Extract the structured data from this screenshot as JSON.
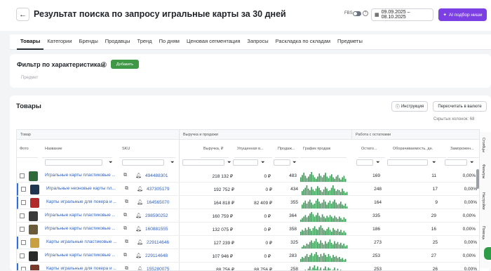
{
  "header": {
    "back_icon": "arrow-left-icon",
    "title": "Результат поиска по запросу игральные карты за 30 дней",
    "fbs_label": "FBS",
    "date_range": "09.09.2025 – 08.10.2025",
    "ai_button": "AI подбор ниши"
  },
  "tabs": [
    "Товары",
    "Категории",
    "Бренды",
    "Продавцы",
    "Тренд",
    "По дням",
    "Ценовая сегментация",
    "Запросы",
    "Раскладка по складам",
    "Предметы"
  ],
  "filter": {
    "title": "Фильтр по характеристикам",
    "add_button": "Добавить",
    "subject_placeholder": "Предмет"
  },
  "products": {
    "title": "Товары",
    "instruction_button": "Инструкция",
    "recalc_button": "Пересчитать в валюте",
    "hidden_columns": "Скрытых колонок: 68",
    "groups": {
      "product": "Товар",
      "revenue": "Выручка и продажи",
      "stock": "Работа с остатками"
    },
    "columns": {
      "photo": "Фото",
      "name": "Название",
      "sku": "SKU",
      "revenue": "Выручка, ₽",
      "lost_revenue": "Упущенная в...",
      "sales": "Продаж...",
      "sales_chart": "График продаж",
      "stock": "Остато...",
      "turnover": "Оборачиваемость, дн.",
      "frozen": "Заморожен..."
    }
  },
  "rows": [
    {
      "name": "Игральные карты пластиковые ...",
      "sku": "494488301",
      "revenue": "218 132 ₽",
      "lost": "0 ₽",
      "sales": "483",
      "stock": "169",
      "turnover": "11",
      "frozen": "0,00%",
      "thumb_color": "#2f6b3a",
      "selected": false
    },
    {
      "name": "Игральные неоновые карты пл...",
      "sku": "437305179",
      "revenue": "192 752 ₽",
      "lost": "0 ₽",
      "sales": "434",
      "stock": "248",
      "turnover": "17",
      "frozen": "0,00%",
      "thumb_color": "#1f3550",
      "selected": true
    },
    {
      "name": "Карты игральные для покера и ...",
      "sku": "164565070",
      "revenue": "164 818 ₽",
      "lost": "82 409 ₽",
      "sales": "355",
      "stock": "164",
      "turnover": "9",
      "frozen": "0,00%",
      "thumb_color": "#b02a2a",
      "selected": true
    },
    {
      "name": "Игральные карты пластиковые ...",
      "sku": "298590252",
      "revenue": "160 759 ₽",
      "lost": "0 ₽",
      "sales": "364",
      "stock": "335",
      "turnover": "29",
      "frozen": "0,00%",
      "thumb_color": "#3a3a3a",
      "selected": false
    },
    {
      "name": "Игральные карты пластиковые ...",
      "sku": "160881555",
      "revenue": "132 075 ₽",
      "lost": "0 ₽",
      "sales": "358",
      "stock": "186",
      "turnover": "16",
      "frozen": "0,00%",
      "thumb_color": "#6a5a3a",
      "selected": false
    },
    {
      "name": "Карты игральные пластиковые ...",
      "sku": "229114646",
      "revenue": "127 239 ₽",
      "lost": "0 ₽",
      "sales": "325",
      "stock": "273",
      "turnover": "25",
      "frozen": "0,00%",
      "thumb_color": "#c8a040",
      "selected": true
    },
    {
      "name": "Игральные карты пластиковые ...",
      "sku": "229114648",
      "revenue": "107 946 ₽",
      "lost": "0 ₽",
      "sales": "283",
      "stock": "253",
      "turnover": "27",
      "frozen": "0,00%",
      "thumb_color": "#2a2a2a",
      "selected": false
    },
    {
      "name": "Карты игральные для покера и ...",
      "sku": "155280075",
      "revenue": "88 756 ₽",
      "lost": "88 756 ₽",
      "sales": "258",
      "stock": "253",
      "turnover": "26",
      "frozen": "0,00%",
      "thumb_color": "#7a3a2a",
      "selected": true
    }
  ],
  "spark_series": [
    [
      6,
      9,
      12,
      8,
      5,
      7,
      10,
      13,
      9,
      6,
      4,
      7,
      11,
      8,
      6,
      9,
      12,
      7,
      5,
      8,
      10,
      6,
      4,
      7,
      9,
      5,
      3,
      6,
      8,
      4
    ],
    [
      5,
      7,
      9,
      12,
      8,
      6,
      10,
      7,
      5,
      8,
      11,
      9,
      6,
      4,
      7,
      10,
      8,
      5,
      6,
      9,
      12,
      8,
      5,
      7,
      6,
      4,
      8,
      5,
      3,
      4
    ],
    [
      4,
      6,
      8,
      5,
      7,
      9,
      6,
      4,
      5,
      8,
      10,
      7,
      5,
      6,
      9,
      7,
      4,
      6,
      8,
      5,
      7,
      9,
      6,
      4,
      5,
      7,
      4,
      3,
      5,
      2
    ],
    [
      3,
      5,
      7,
      9,
      6,
      8,
      11,
      13,
      10,
      7,
      9,
      12,
      8,
      6,
      10,
      7,
      5,
      8,
      6,
      9,
      7,
      5,
      8,
      6,
      4,
      7,
      5,
      3,
      6,
      4
    ],
    [
      4,
      6,
      5,
      8,
      6,
      9,
      7,
      5,
      8,
      10,
      7,
      6,
      9,
      11,
      8,
      6,
      5,
      7,
      9,
      6,
      4,
      8,
      6,
      5,
      7,
      4,
      6,
      3,
      5,
      3
    ],
    [
      2,
      4,
      3,
      6,
      5,
      8,
      10,
      7,
      9,
      12,
      8,
      6,
      10,
      7,
      5,
      9,
      6,
      8,
      11,
      7,
      5,
      9,
      6,
      8,
      5,
      7,
      4,
      6,
      3,
      4
    ],
    [
      3,
      5,
      4,
      6,
      8,
      5,
      7,
      9,
      6,
      8,
      10,
      7,
      5,
      8,
      6,
      9,
      7,
      5,
      8,
      6,
      4,
      7,
      5,
      6,
      4,
      5,
      3,
      4,
      2,
      3
    ],
    [
      2,
      3,
      5,
      4,
      6,
      8,
      5,
      7,
      9,
      6,
      8,
      5,
      7,
      4,
      6,
      8,
      5,
      7,
      6,
      4,
      5,
      7,
      4,
      6,
      3,
      5,
      4,
      3,
      2,
      3
    ]
  ],
  "side_panel": [
    "Столбцы",
    "Фильтры",
    "Настройки",
    "Помощь"
  ],
  "colors": {
    "accent_purple": "#7b3fe4",
    "green": "#3f9846",
    "link_blue": "#2f5fbf",
    "chart_green": "#3d9a57"
  }
}
